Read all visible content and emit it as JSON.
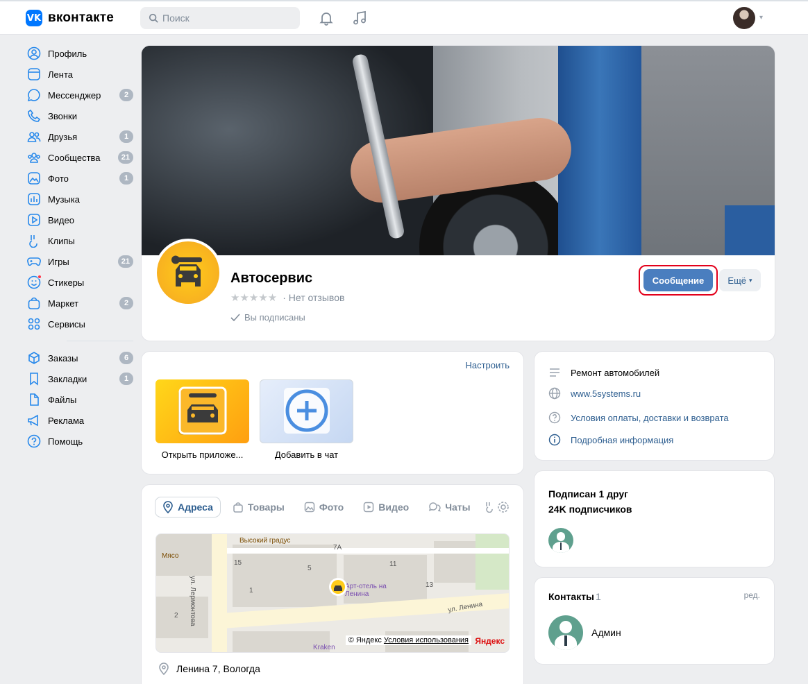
{
  "header": {
    "logo_mark": "VK",
    "logo_text": "вконтакте",
    "search_placeholder": "Поиск"
  },
  "sidebar": {
    "items": [
      {
        "label": "Профиль",
        "icon": "user-circle-icon",
        "badge": ""
      },
      {
        "label": "Лента",
        "icon": "newsfeed-icon",
        "badge": ""
      },
      {
        "label": "Мессенджер",
        "icon": "message-icon",
        "badge": "2"
      },
      {
        "label": "Звонки",
        "icon": "phone-icon",
        "badge": ""
      },
      {
        "label": "Друзья",
        "icon": "friends-icon",
        "badge": "1"
      },
      {
        "label": "Сообщества",
        "icon": "communities-icon",
        "badge": "21"
      },
      {
        "label": "Фото",
        "icon": "photo-icon",
        "badge": "1"
      },
      {
        "label": "Музыка",
        "icon": "music-icon",
        "badge": ""
      },
      {
        "label": "Видео",
        "icon": "video-icon",
        "badge": ""
      },
      {
        "label": "Клипы",
        "icon": "clips-icon",
        "badge": ""
      },
      {
        "label": "Игры",
        "icon": "gamepad-icon",
        "badge": "21"
      },
      {
        "label": "Стикеры",
        "icon": "smile-icon",
        "badge": ""
      },
      {
        "label": "Маркет",
        "icon": "market-bag-icon",
        "badge": "2"
      },
      {
        "label": "Сервисы",
        "icon": "services-grid-icon",
        "badge": ""
      }
    ],
    "items2": [
      {
        "label": "Заказы",
        "icon": "box-icon",
        "badge": "6"
      },
      {
        "label": "Закладки",
        "icon": "bookmark-icon",
        "badge": "1"
      },
      {
        "label": "Файлы",
        "icon": "file-icon",
        "badge": ""
      },
      {
        "label": "Реклама",
        "icon": "megaphone-icon",
        "badge": ""
      },
      {
        "label": "Помощь",
        "icon": "help-circle-icon",
        "badge": ""
      }
    ]
  },
  "group": {
    "name": "Автосервис",
    "rating_stars": 0,
    "reviews": "· Нет отзывов",
    "subscribed": "Вы подписаны",
    "message_button": "Сообщение",
    "more_button": "Ещё"
  },
  "apps": {
    "configure": "Настроить",
    "items": [
      {
        "label": "Открыть приложе..."
      },
      {
        "label": "Добавить в чат"
      }
    ]
  },
  "tabs": [
    {
      "label": "Адреса",
      "icon": "pin-icon",
      "active": true
    },
    {
      "label": "Товары",
      "icon": "bag-icon",
      "active": false
    },
    {
      "label": "Фото",
      "icon": "photo-icon",
      "active": false
    },
    {
      "label": "Видео",
      "icon": "video-icon",
      "active": false
    },
    {
      "label": "Чаты",
      "icon": "chats-icon",
      "active": false
    }
  ],
  "map": {
    "labels": {
      "poi1": "Высокий градус",
      "poi2": "Мясо",
      "street1": "ул. Лермонтова",
      "street2": "ул. Ленина",
      "hotel": "Арт-отель на Ленина",
      "kraken": "Kraken",
      "n7a": "7А",
      "n15": "15",
      "n5": "5",
      "n11": "11",
      "n13": "13",
      "n1": "1",
      "n2": "2"
    },
    "credit_prefix": "© Яндекс",
    "credit_link": "Условия использования",
    "brand": "Яндекс"
  },
  "address": "Ленина 7, Вологда",
  "info": {
    "category": "Ремонт автомобилей",
    "website": "www.5systems.ru",
    "terms": "Условия оплаты, доставки и возврата",
    "details": "Подробная информация"
  },
  "subscribers": {
    "friends": "Подписан 1 друг",
    "count": "24K подписчиков"
  },
  "contacts": {
    "title": "Контакты",
    "count": "1",
    "edit": "ред.",
    "name": "Админ"
  },
  "colors": {
    "accent": "#2688eb",
    "button": "#4a7ebf",
    "link": "#2c5d8f",
    "highlight_ring": "#e3001b"
  }
}
